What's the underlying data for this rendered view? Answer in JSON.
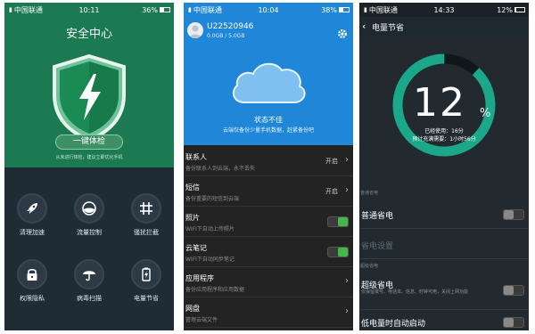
{
  "screen1": {
    "status": {
      "carrier": "中国联通",
      "time": "10:11",
      "battery": "36%"
    },
    "title": "安全中心",
    "check_button": "一键体检",
    "hint": "从未进行体检，建议立即优化手机",
    "tiles": [
      {
        "label": "清理加速",
        "icon": "rocket-icon"
      },
      {
        "label": "流量控制",
        "icon": "data-usage-icon"
      },
      {
        "label": "骚扰拦截",
        "icon": "grid-block-icon"
      },
      {
        "label": "权限隐私",
        "icon": "lock-icon"
      },
      {
        "label": "病毒扫描",
        "icon": "umbrella-icon"
      },
      {
        "label": "电量节省",
        "icon": "battery-icon"
      }
    ],
    "colors": {
      "header": "#1b7a52",
      "body": "#1f2c36"
    }
  },
  "screen2": {
    "status": {
      "carrier": "中国联通",
      "time": "10:04",
      "battery": "38%"
    },
    "user_id": "U22520946",
    "quota": "0.0GB / 5.0GB",
    "cloud_status": "状态不佳",
    "cloud_status_sub": "云端仅备份少量手机数据，赶紧备份吧",
    "rows": [
      {
        "title": "联系人",
        "desc": "备份联系人到云端，永不丢失",
        "value": "开启",
        "control": "chevron"
      },
      {
        "title": "短信",
        "desc": "备份重要的短信到云端",
        "value": "开启",
        "control": "chevron"
      },
      {
        "title": "照片",
        "desc": "WIFI下自动上传照片",
        "value": "",
        "control": "toggle-on"
      },
      {
        "title": "云笔记",
        "desc": "WIFI下自动同步笔记",
        "value": "",
        "control": "toggle-on"
      },
      {
        "title": "应用程序",
        "desc": "备份应用程序和应用数据",
        "value": "",
        "control": "chevron"
      },
      {
        "title": "网盘",
        "desc": "管理云端文件",
        "value": "",
        "control": "chevron"
      }
    ],
    "colors": {
      "header": "#1f86d8"
    }
  },
  "screen3": {
    "status": {
      "carrier": "中国联通",
      "time": "14:33",
      "battery": "12%"
    },
    "title": "电量节省",
    "percent": "12",
    "percent_sign": "%",
    "used_time": "已经使用：16分",
    "remaining": "预计充满需要：1小时56分",
    "battery_level": 12,
    "section_normal": "普通省电",
    "row_normal": "普通省电",
    "row_settings": "省电设置",
    "section_super": "超级省电",
    "row_super": "超级省电",
    "row_super_desc": "仅保留拨号、电话本、信息、时钟可用，关闭上网功能",
    "row_low": "低电量时自动启动",
    "colors": {
      "ring": "#1aa78a",
      "ring_track": "#11161a"
    }
  }
}
